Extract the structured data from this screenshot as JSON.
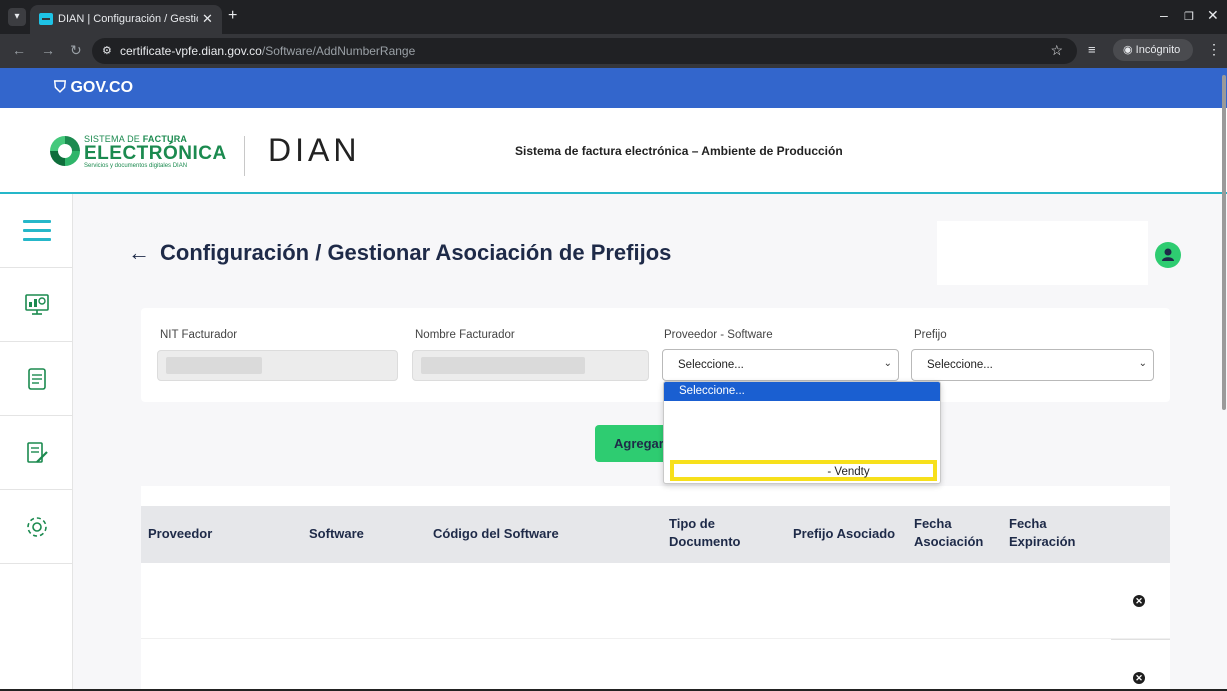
{
  "browser": {
    "tab_title": "DIAN | Configuración / Gestion",
    "url_domain": "certificate-vpfe.dian.gov.co",
    "url_path": "/Software/AddNumberRange",
    "incognito_label": "Incógnito"
  },
  "gov_bar": {
    "logo_text": "GOV.CO",
    "color": "#3366cc"
  },
  "header": {
    "sfe_line1_prefix": "SISTEMA DE ",
    "sfe_line1_bold": "FACTURA",
    "sfe_line2": "ELECTRÓNICA",
    "sfe_line3": "Servicios y documentos digitales DIAN",
    "dian_logo": "DIAN",
    "title": "Sistema de factura electrónica – Ambiente de Producción"
  },
  "page": {
    "title": "Configuración / Gestionar Asociación de Prefijos"
  },
  "filters": {
    "nit_label": "NIT Facturador",
    "nombre_label": "Nombre Facturador",
    "proveedor_label": "Proveedor - Software",
    "proveedor_value": "Seleccione...",
    "prefijo_label": "Prefijo",
    "prefijo_value": "Seleccione..."
  },
  "dropdown": {
    "selected_option": "Seleccione...",
    "highlighted_option": "- Vendty"
  },
  "actions": {
    "agregar_label": "Agregar"
  },
  "table": {
    "headers": [
      "Proveedor",
      "Software",
      "Código del Software",
      "Tipo de Documento",
      "Prefijo Asociado",
      "Fecha Asociación",
      "Fecha Expiración"
    ]
  },
  "colors": {
    "accent_green": "#2ecc71",
    "accent_teal": "#25b7c9",
    "dark_navy": "#1e2a48",
    "highlight_yellow": "#f7e01b"
  }
}
